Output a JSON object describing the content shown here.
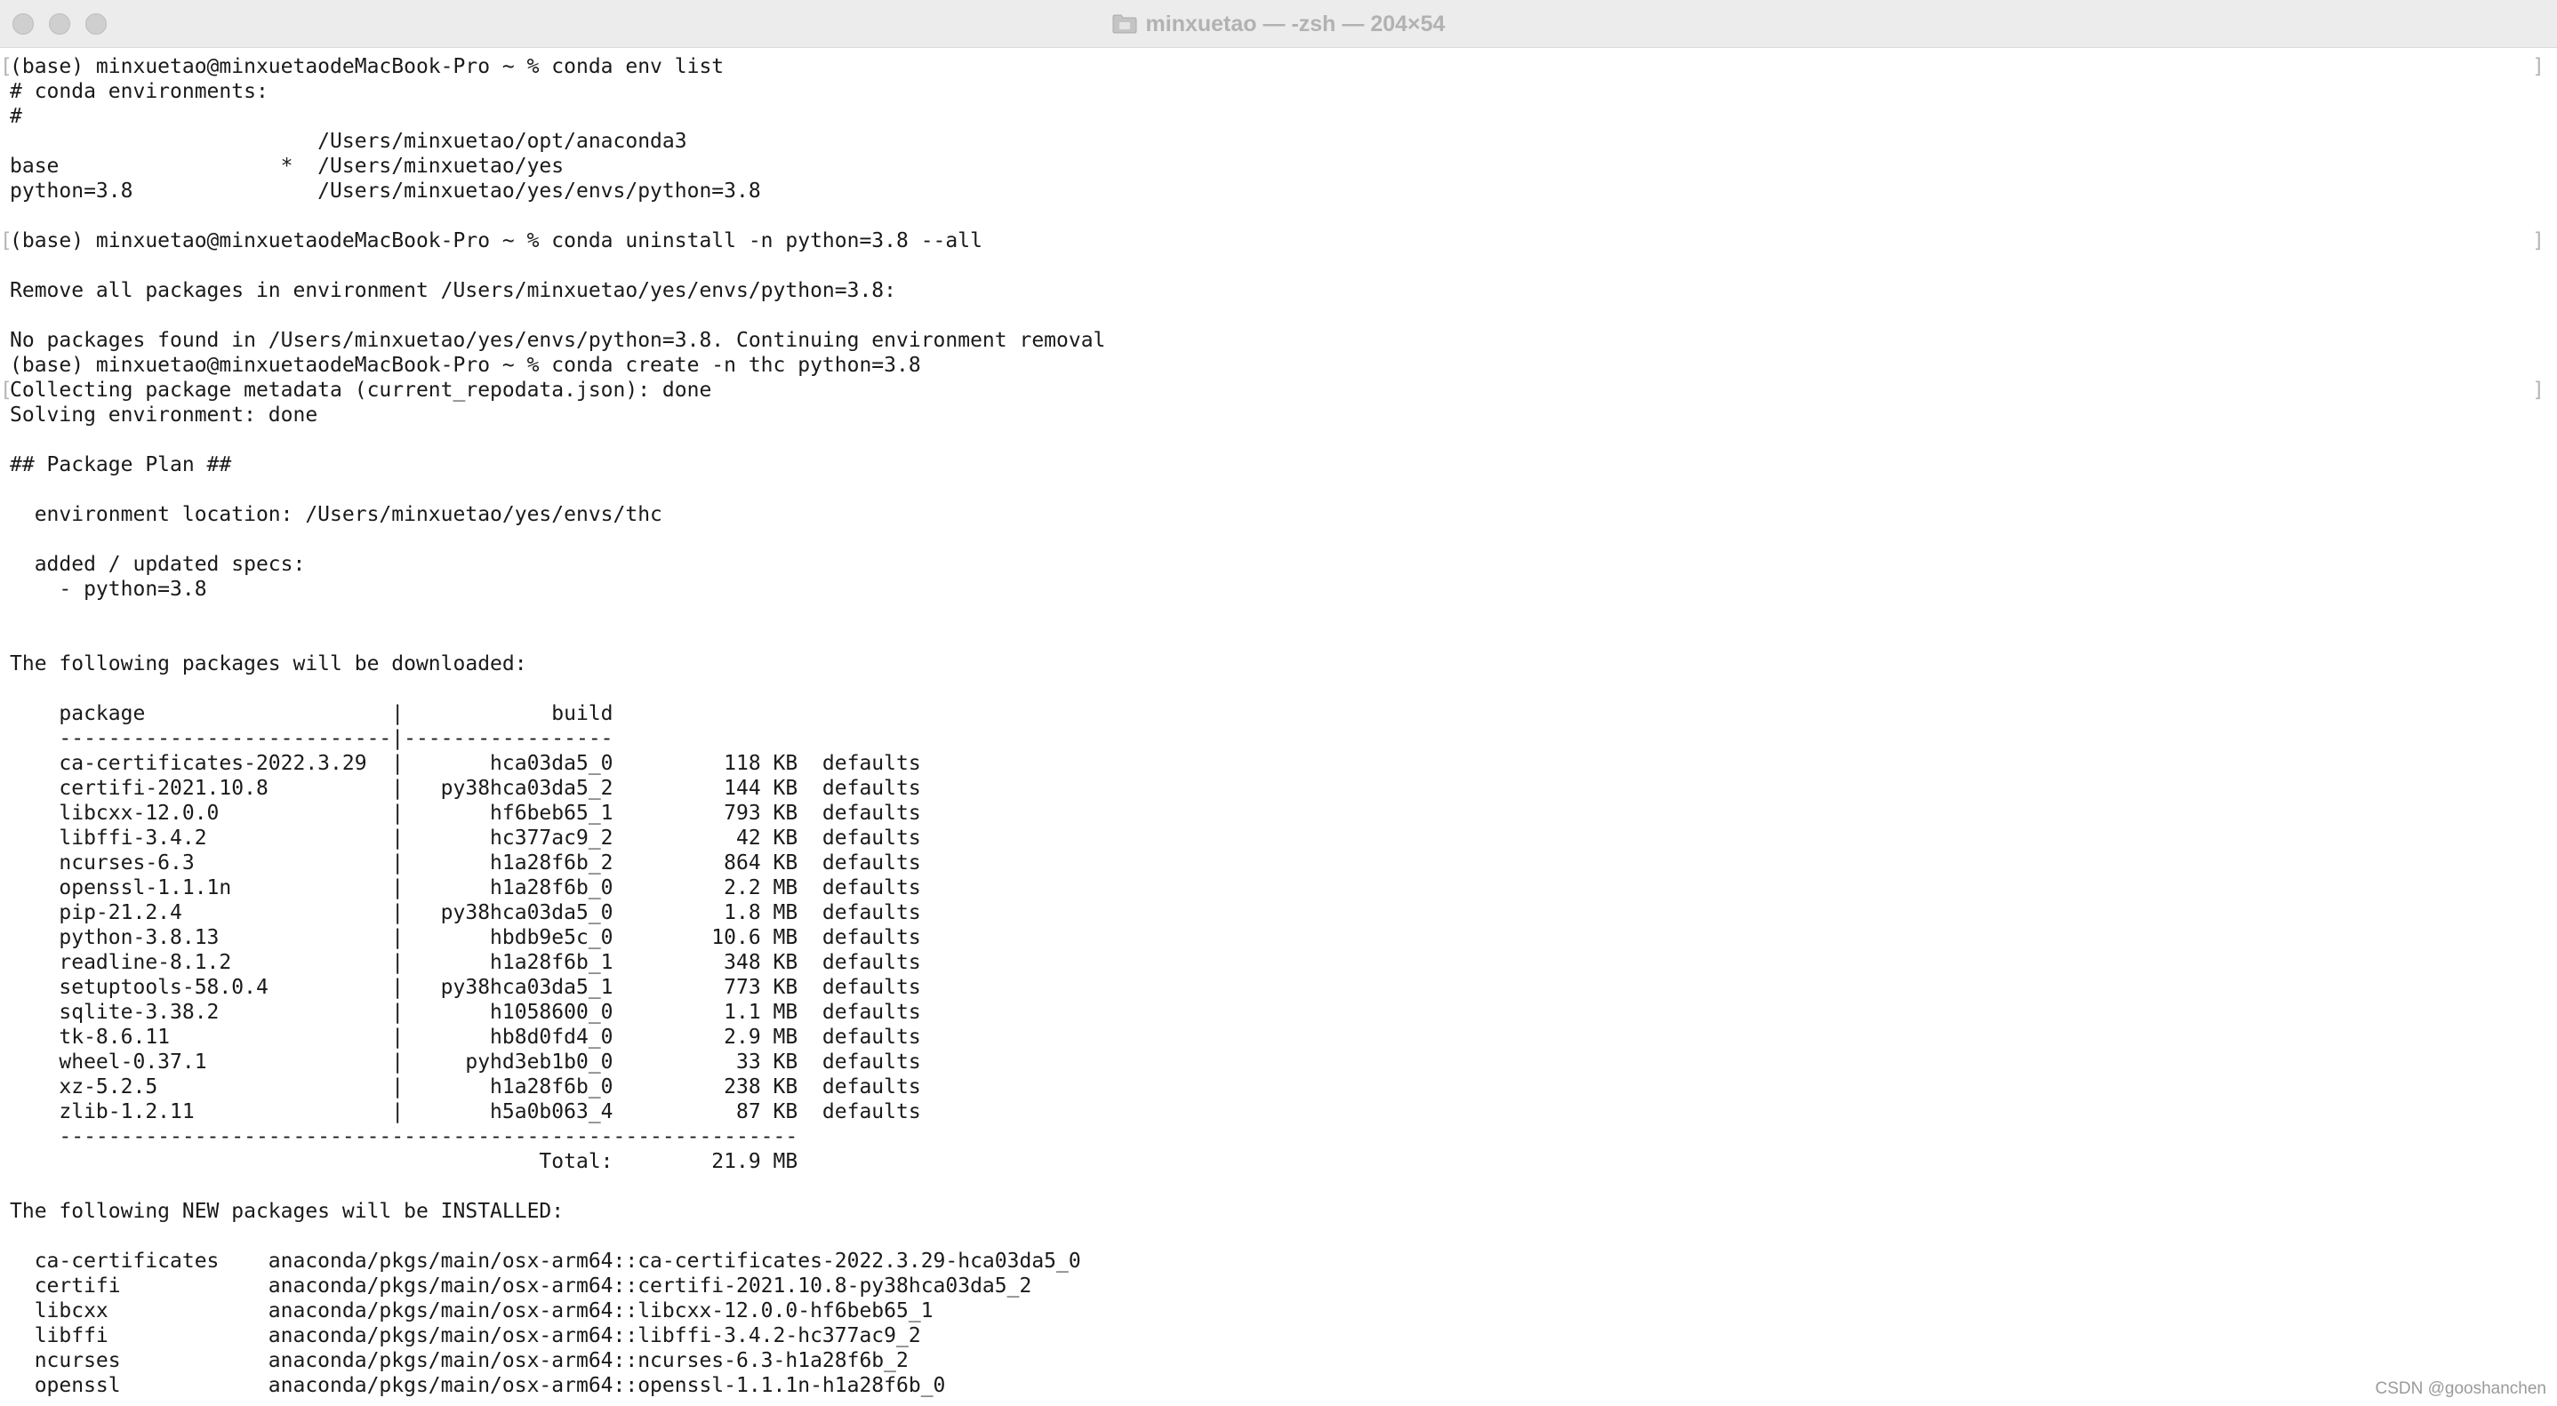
{
  "window": {
    "title": "minxuetao — -zsh — 204×54",
    "folder_icon": "folder-icon",
    "buttons": [
      "close-button",
      "minimize-button",
      "zoom-button"
    ]
  },
  "terminal": {
    "lines": [
      {
        "text": "(base) minxuetao@minxuetaodeMacBook-Pro ~ % conda env list",
        "mark": true
      },
      {
        "text": "# conda environments:"
      },
      {
        "text": "#"
      },
      {
        "text": "                         /Users/minxuetao/opt/anaconda3"
      },
      {
        "text": "base                  *  /Users/minxuetao/yes"
      },
      {
        "text": "python=3.8               /Users/minxuetao/yes/envs/python=3.8"
      },
      {
        "text": ""
      },
      {
        "text": "(base) minxuetao@minxuetaodeMacBook-Pro ~ % conda uninstall -n python=3.8 --all",
        "mark": true
      },
      {
        "text": ""
      },
      {
        "text": "Remove all packages in environment /Users/minxuetao/yes/envs/python=3.8:"
      },
      {
        "text": ""
      },
      {
        "text": "No packages found in /Users/minxuetao/yes/envs/python=3.8. Continuing environment removal"
      },
      {
        "text": "(base) minxuetao@minxuetaodeMacBook-Pro ~ % conda create -n thc python=3.8"
      },
      {
        "text": "Collecting package metadata (current_repodata.json): done",
        "mark": true
      },
      {
        "text": "Solving environment: done"
      },
      {
        "text": ""
      },
      {
        "text": "## Package Plan ##"
      },
      {
        "text": ""
      },
      {
        "text": "  environment location: /Users/minxuetao/yes/envs/thc"
      },
      {
        "text": ""
      },
      {
        "text": "  added / updated specs:"
      },
      {
        "text": "    - python=3.8"
      },
      {
        "text": ""
      },
      {
        "text": ""
      },
      {
        "text": "The following packages will be downloaded:"
      },
      {
        "text": ""
      },
      {
        "text": "    package                    |            build"
      },
      {
        "text": "    ---------------------------|-----------------"
      },
      {
        "text": "    ca-certificates-2022.3.29  |       hca03da5_0         118 KB  defaults"
      },
      {
        "text": "    certifi-2021.10.8          |   py38hca03da5_2         144 KB  defaults"
      },
      {
        "text": "    libcxx-12.0.0              |       hf6beb65_1         793 KB  defaults"
      },
      {
        "text": "    libffi-3.4.2               |       hc377ac9_2          42 KB  defaults"
      },
      {
        "text": "    ncurses-6.3                |       h1a28f6b_2         864 KB  defaults"
      },
      {
        "text": "    openssl-1.1.1n             |       h1a28f6b_0         2.2 MB  defaults"
      },
      {
        "text": "    pip-21.2.4                 |   py38hca03da5_0         1.8 MB  defaults"
      },
      {
        "text": "    python-3.8.13              |       hbdb9e5c_0        10.6 MB  defaults"
      },
      {
        "text": "    readline-8.1.2             |       h1a28f6b_1         348 KB  defaults"
      },
      {
        "text": "    setuptools-58.0.4          |   py38hca03da5_1         773 KB  defaults"
      },
      {
        "text": "    sqlite-3.38.2              |       h1058600_0         1.1 MB  defaults"
      },
      {
        "text": "    tk-8.6.11                  |       hb8d0fd4_0         2.9 MB  defaults"
      },
      {
        "text": "    wheel-0.37.1               |     pyhd3eb1b0_0          33 KB  defaults"
      },
      {
        "text": "    xz-5.2.5                   |       h1a28f6b_0         238 KB  defaults"
      },
      {
        "text": "    zlib-1.2.11                |       h5a0b063_4          87 KB  defaults"
      },
      {
        "text": "    ------------------------------------------------------------"
      },
      {
        "text": "                                           Total:        21.9 MB"
      },
      {
        "text": ""
      },
      {
        "text": "The following NEW packages will be INSTALLED:"
      },
      {
        "text": ""
      },
      {
        "text": "  ca-certificates    anaconda/pkgs/main/osx-arm64::ca-certificates-2022.3.29-hca03da5_0"
      },
      {
        "text": "  certifi            anaconda/pkgs/main/osx-arm64::certifi-2021.10.8-py38hca03da5_2"
      },
      {
        "text": "  libcxx             anaconda/pkgs/main/osx-arm64::libcxx-12.0.0-hf6beb65_1"
      },
      {
        "text": "  libffi             anaconda/pkgs/main/osx-arm64::libffi-3.4.2-hc377ac9_2"
      },
      {
        "text": "  ncurses            anaconda/pkgs/main/osx-arm64::ncurses-6.3-h1a28f6b_2"
      },
      {
        "text": "  openssl            anaconda/pkgs/main/osx-arm64::openssl-1.1.1n-h1a28f6b_0"
      }
    ]
  },
  "watermark": "CSDN @gooshanchen"
}
